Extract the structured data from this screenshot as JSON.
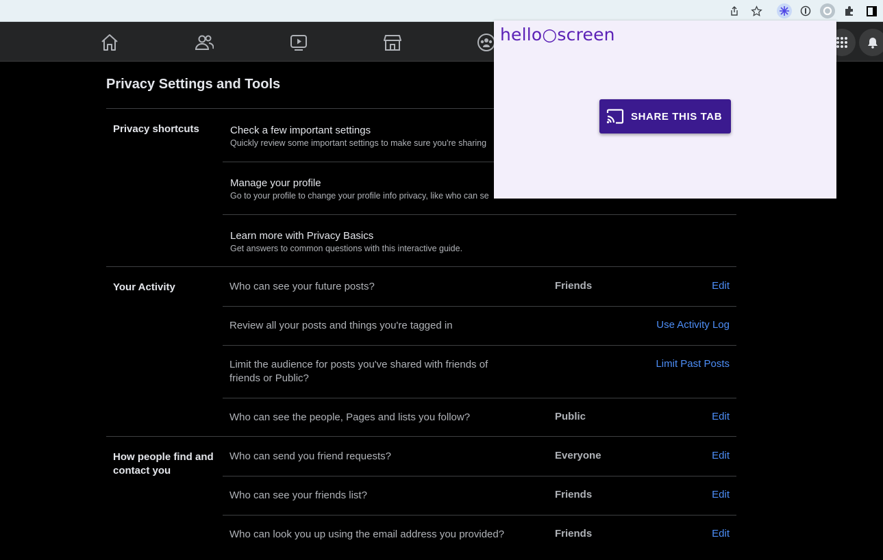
{
  "browser": {
    "toolbar_icons": [
      "share-icon",
      "bookmark-star-icon",
      "extension-snowflake-icon",
      "extension-info-icon",
      "helloscreen-extension-icon",
      "extensions-puzzle-icon",
      "sidebar-icon"
    ]
  },
  "nav": {
    "icons": [
      "home-icon",
      "friends-icon",
      "watch-icon",
      "marketplace-icon",
      "groups-icon",
      "menu-grid-icon",
      "notifications-icon"
    ]
  },
  "page": {
    "title": "Privacy Settings and Tools"
  },
  "sections": {
    "shortcuts": {
      "label": "Privacy shortcuts",
      "items": [
        {
          "title": "Check a few important settings",
          "desc": "Quickly review some important settings to make sure you're sharing"
        },
        {
          "title": "Manage your profile",
          "desc": "Go to your profile to change your profile info privacy, like who can se"
        },
        {
          "title": "Learn more with Privacy Basics",
          "desc": "Get answers to common questions with this interactive guide."
        }
      ]
    },
    "activity": {
      "label": "Your Activity",
      "rows": [
        {
          "question": "Who can see your future posts?",
          "value": "Friends",
          "action": "Edit"
        },
        {
          "question": "Review all your posts and things you're tagged in",
          "value": "",
          "action": "Use Activity Log"
        },
        {
          "question": "Limit the audience for posts you've shared with friends of friends or Public?",
          "value": "",
          "action": "Limit Past Posts"
        },
        {
          "question": "Who can see the people, Pages and lists you follow?",
          "value": "Public",
          "action": "Edit"
        }
      ]
    },
    "find": {
      "label": "How people find and contact you",
      "rows": [
        {
          "question": "Who can send you friend requests?",
          "value": "Everyone",
          "action": "Edit"
        },
        {
          "question": "Who can see your friends list?",
          "value": "Friends",
          "action": "Edit"
        },
        {
          "question": "Who can look you up using the email address you provided?",
          "value": "Friends",
          "action": "Edit"
        }
      ]
    }
  },
  "popup": {
    "logo": "hello○screen",
    "share_label": "SHARE THIS TAB"
  },
  "colors": {
    "link": "#4d8ef7",
    "background": "#000000",
    "nav": "#242526",
    "popup_bg": "#f3effb",
    "share_button": "#3b1a8f",
    "logo": "#5b21b6"
  }
}
